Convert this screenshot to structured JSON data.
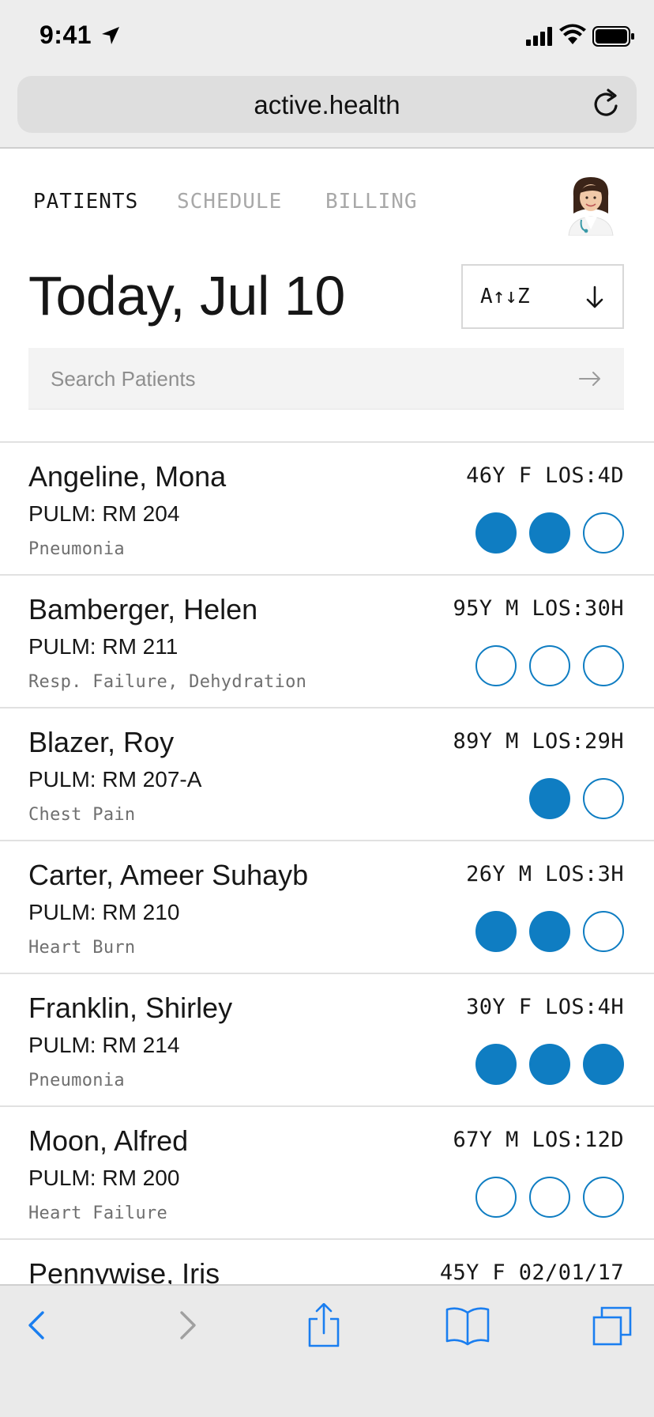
{
  "status_bar": {
    "time": "9:41",
    "icons": [
      "location-arrow-icon",
      "cellular-signal-icon",
      "wifi-icon",
      "battery-icon"
    ]
  },
  "browser": {
    "url": "active.health",
    "toolbar_icons": [
      "back-icon",
      "forward-icon",
      "share-icon",
      "bookmarks-icon",
      "tabs-icon"
    ]
  },
  "nav": {
    "tabs": [
      {
        "label": "PATIENTS",
        "active": true
      },
      {
        "label": "SCHEDULE",
        "active": false
      },
      {
        "label": "BILLING",
        "active": false
      }
    ]
  },
  "header": {
    "title": "Today, Jul 10",
    "sort_label": "A↑↓Z"
  },
  "search": {
    "placeholder": "Search Patients",
    "value": ""
  },
  "colors": {
    "accent": "#0f7dc2",
    "text": "#171717",
    "muted": "#a8a8a8"
  },
  "patients": [
    {
      "name": "Angeline, Mona",
      "room": "PULM: RM 204",
      "diagnosis": "Pneumonia",
      "meta": "46Y F LOS:4D",
      "indicators": [
        true,
        true,
        false
      ]
    },
    {
      "name": "Bamberger, Helen",
      "room": "PULM: RM 211",
      "diagnosis": "Resp. Failure, Dehydration",
      "meta": "95Y M LOS:30H",
      "indicators": [
        false,
        false,
        false
      ]
    },
    {
      "name": "Blazer, Roy",
      "room": "PULM: RM 207-A",
      "diagnosis": "Chest Pain",
      "meta": "89Y M LOS:29H",
      "indicators": [
        true,
        false
      ]
    },
    {
      "name": "Carter, Ameer Suhayb",
      "room": "PULM: RM 210",
      "diagnosis": "Heart Burn",
      "meta": "26Y M LOS:3H",
      "indicators": [
        true,
        true,
        false
      ]
    },
    {
      "name": "Franklin, Shirley",
      "room": "PULM: RM 214",
      "diagnosis": "Pneumonia",
      "meta": "30Y F LOS:4H",
      "indicators": [
        true,
        true,
        true
      ]
    },
    {
      "name": "Moon, Alfred",
      "room": "PULM: RM 200",
      "diagnosis": "Heart Failure",
      "meta": "67Y M LOS:12D",
      "indicators": [
        false,
        false,
        false
      ]
    },
    {
      "name": "Pennywise, Iris",
      "room": "",
      "diagnosis": "",
      "meta": "45Y F 02/01/17",
      "indicators": []
    }
  ]
}
